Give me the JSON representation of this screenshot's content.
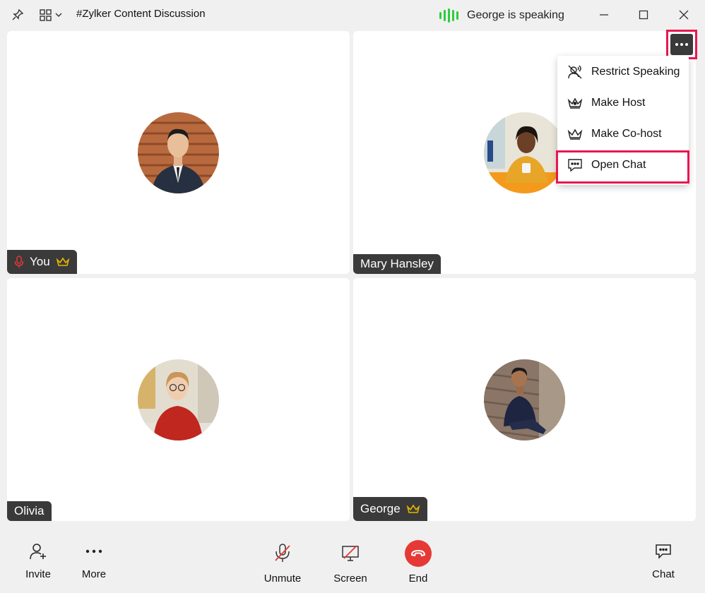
{
  "window": {
    "title": "#Zylker Content Discussion",
    "speaking_status": "George is speaking"
  },
  "participants": [
    {
      "name": "You",
      "muted_icon": "mic-icon",
      "role": "host"
    },
    {
      "name": "Mary Hansley"
    },
    {
      "name": "Olivia"
    },
    {
      "name": "George",
      "role": "host"
    }
  ],
  "context_menu": {
    "items": [
      {
        "label": "Restrict Speaking",
        "icon": "restrict-speaking-icon"
      },
      {
        "label": "Make Host",
        "icon": "crown-filled-icon"
      },
      {
        "label": "Make Co-host",
        "icon": "crown-outline-icon"
      },
      {
        "label": "Open Chat",
        "icon": "chat-icon",
        "highlighted": true
      }
    ]
  },
  "toolbar": {
    "invite": "Invite",
    "more": "More",
    "unmute": "Unmute",
    "screen": "Screen",
    "end": "End",
    "chat": "Chat"
  },
  "colors": {
    "highlight": "#e8174f",
    "speaking": "#2ecc40",
    "end": "#e53935",
    "crown": "#e6b400"
  }
}
